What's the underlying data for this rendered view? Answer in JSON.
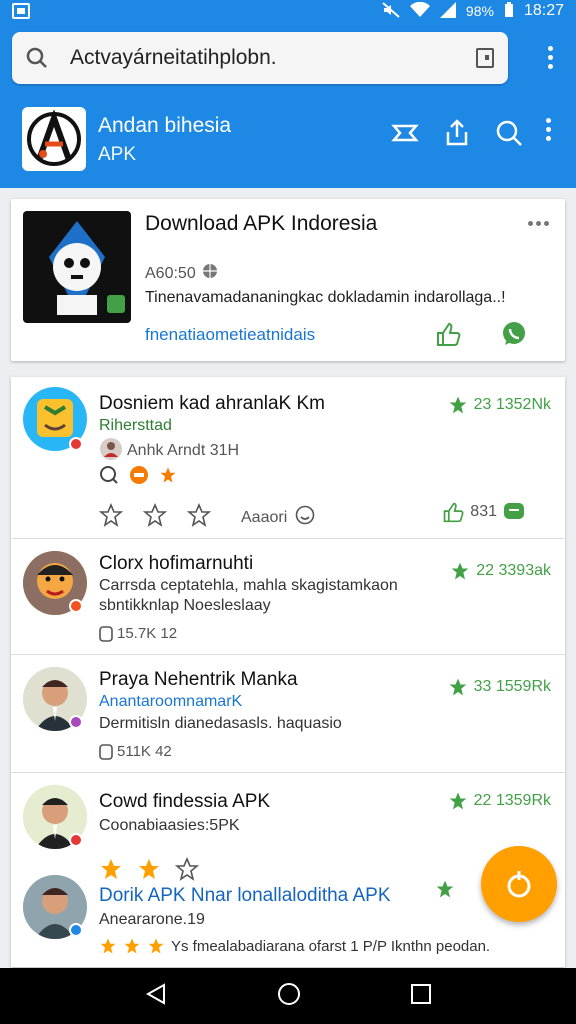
{
  "status_bar": {
    "battery": "98%",
    "time": "18:27"
  },
  "search": {
    "text": "Actvayárneitatihplobn."
  },
  "app_bar": {
    "title": "Andan bihesia",
    "subtitle": "APK"
  },
  "featured": {
    "title": "Download APK Indoresia",
    "meta": "A60:50",
    "description": "Tinenavamadananingkac dokladamin indarollaga..!",
    "link": "fnenatiaometieatnidais"
  },
  "list": [
    {
      "title": "Dosniem kad ahranlaK Km",
      "subtitle": "Rihersttad",
      "author": "Anhk Arndt 31H",
      "rating": "23 1352Nk",
      "like_count": "Aaaori",
      "share_count": "831"
    },
    {
      "title": "Clorx hofimarnuhti",
      "subtitle": "Carrsda ceptatehla, mahla skagistamkaon",
      "subtitle2": "sbntikknlap Noesleslaay",
      "meta": "15.7K 12",
      "rating": "22 3393ak"
    },
    {
      "title": "Praya Nehentrik Manka",
      "subtitle": "AnantaroomnamarK",
      "subtitle2": "Dermitisln dianedasasls. haquasio",
      "meta": "511K 42",
      "rating": "33 1559Rk"
    },
    {
      "title": "Cowd findessia APK",
      "subtitle": "Coonabiaasies:5PK",
      "rating": "22 1359Rk"
    },
    {
      "title": "Dorik APK Nnar lonallaloditha APK",
      "subtitle": "Aneararone.19",
      "description": "Ys fmealabadiarana ofarst 1 P/P Iknthn peodan."
    }
  ],
  "colors": {
    "primary": "#1e88e5",
    "accent": "#ffa000",
    "green": "#43a047",
    "link": "#1976d2"
  }
}
